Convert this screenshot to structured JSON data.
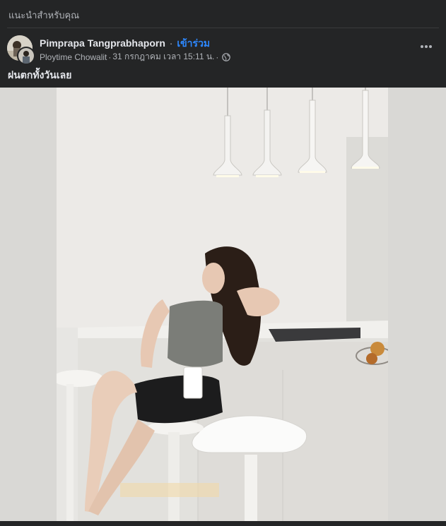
{
  "section": {
    "label": "แนะนำสำหรับคุณ"
  },
  "post": {
    "author_name": "Pimprapa Tangprabhaporn",
    "separator": "·",
    "join_label": "เข้าร่วม",
    "poster": "Ploytime Chowalit",
    "date": "31 กรกฎาคม เวลา 15:11 น.",
    "privacy_icon": "globe-icon",
    "more_icon": "more-options-icon",
    "text": "ฝนตกทั้งวันเลย"
  },
  "colors": {
    "background": "#242526",
    "text_primary": "#e4e6eb",
    "text_secondary": "#b0b3b8",
    "link": "#2d88ff"
  }
}
